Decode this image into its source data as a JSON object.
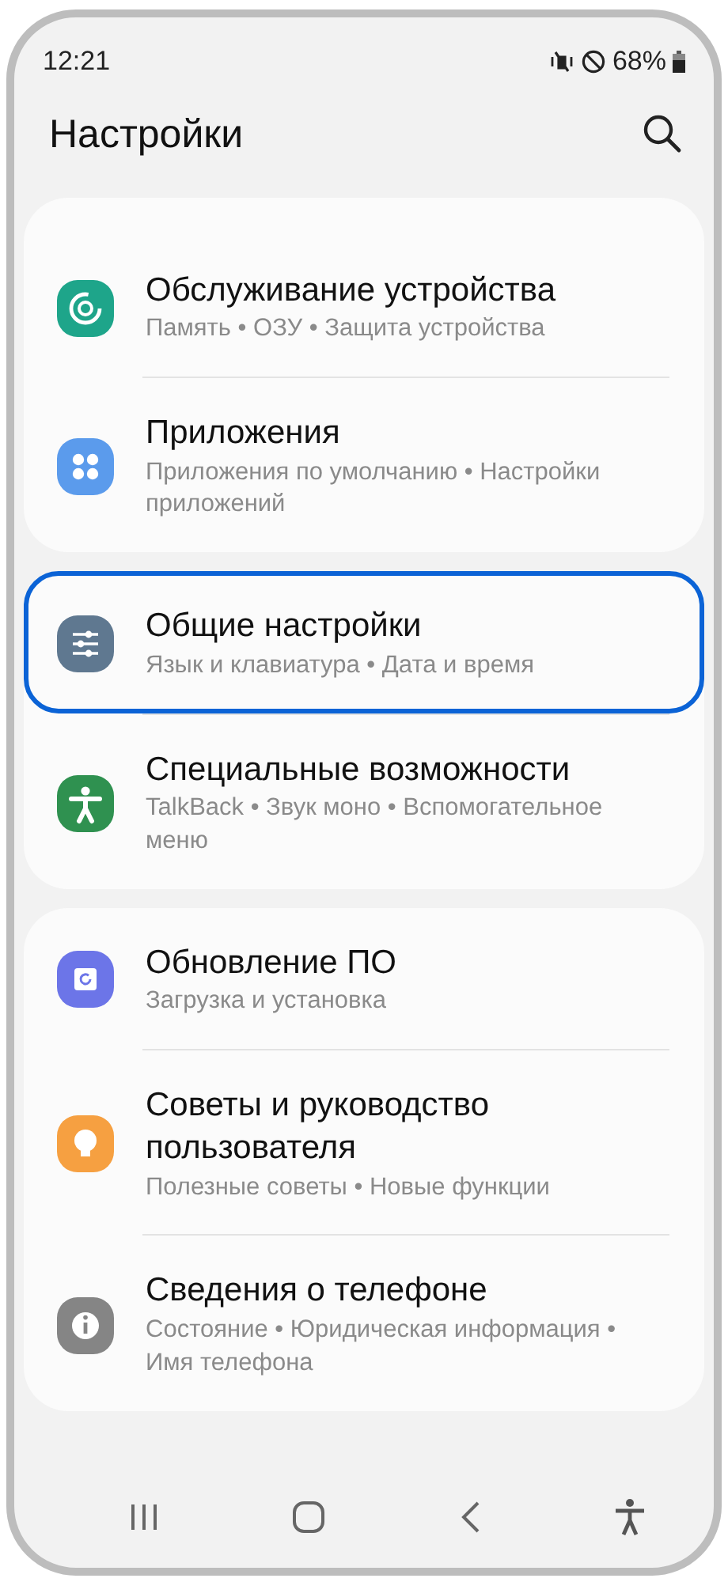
{
  "status_bar": {
    "time": "12:21",
    "battery": "68%"
  },
  "header": {
    "title": "Настройки"
  },
  "groups": [
    {
      "items": [
        {
          "kind": "maintenance",
          "color": "#1ea58a",
          "title": "Обслуживание устройства",
          "subtitle": "Память  •  ОЗУ  •  Защита устройства",
          "selected": false
        },
        {
          "kind": "apps",
          "color": "#5b9bec",
          "title": "Приложения",
          "subtitle": "Приложения по умолчанию  •  Настройки приложений",
          "selected": false
        }
      ]
    },
    {
      "items": [
        {
          "kind": "sliders",
          "color": "#5f7890",
          "title": "Общие настройки",
          "subtitle": "Язык и клавиатура  •  Дата и время",
          "selected": true
        },
        {
          "kind": "accessibility",
          "color": "#2f9150",
          "title": "Специальные возможности",
          "subtitle": "TalkBack  •  Звук моно  •  Вспомогательное меню",
          "selected": false
        }
      ]
    },
    {
      "items": [
        {
          "kind": "update",
          "color": "#6c75e8",
          "title": "Обновление ПО",
          "subtitle": "Загрузка и установка",
          "selected": false
        },
        {
          "kind": "bulb",
          "color": "#f6a041",
          "title": "Советы и руководство пользователя",
          "subtitle": "Полезные советы  •  Новые функции",
          "selected": false
        },
        {
          "kind": "info",
          "color": "#858585",
          "title": "Сведения о телефоне",
          "subtitle": "Состояние  •  Юридическая информация  •  Имя телефона",
          "selected": false
        }
      ]
    }
  ]
}
